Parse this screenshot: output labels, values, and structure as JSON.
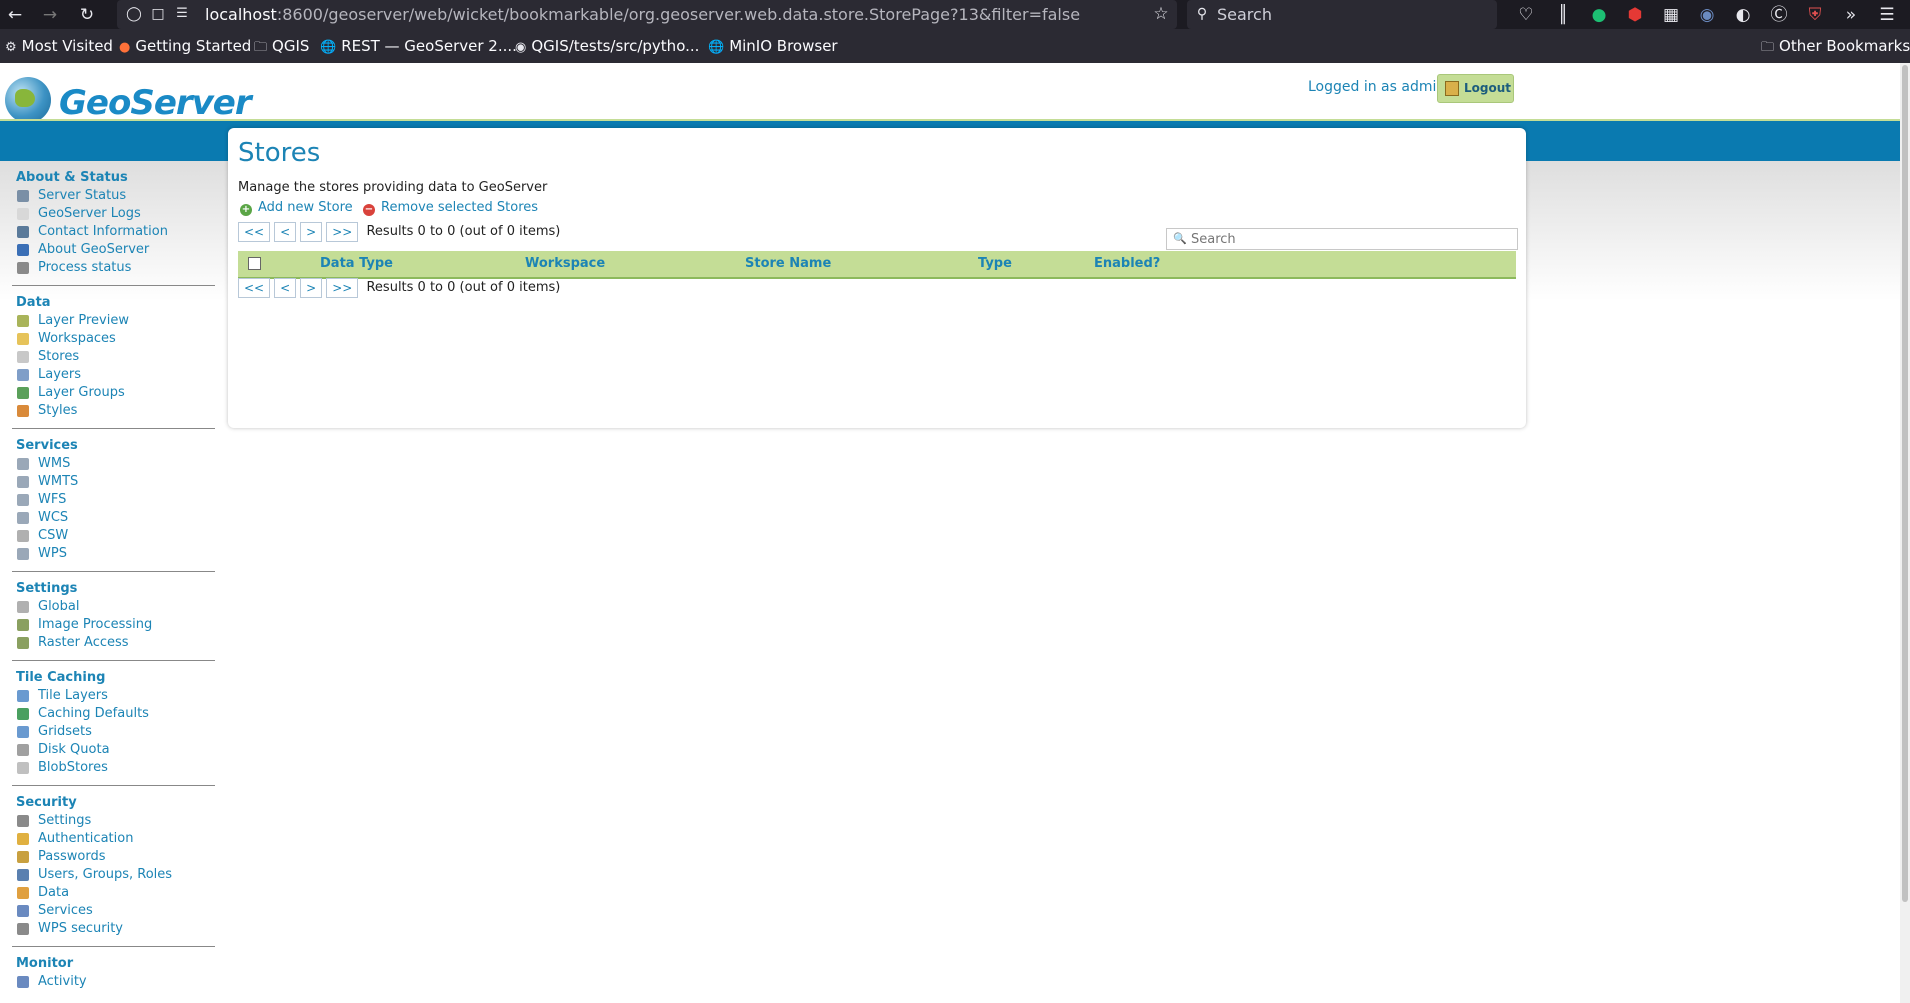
{
  "browser": {
    "url_host": "localhost",
    "url_path": ":8600/geoserver/web/wicket/bookmarkable/org.geoserver.web.data.store.StorePage?13&filter=false",
    "search_placeholder": "Search",
    "bookmarks": [
      "Most Visited",
      "Getting Started",
      "QGIS",
      "REST — GeoServer 2....",
      "QGIS/tests/src/pytho...",
      "MinIO Browser"
    ],
    "other_bookmarks": "Other Bookmarks"
  },
  "header": {
    "logo_text": "GeoServer",
    "logged_in": "Logged in as admin.",
    "logout_label": "Logout"
  },
  "sidebar": [
    {
      "title": "About & Status",
      "items": [
        {
          "label": "Server Status",
          "icon": "server-icon",
          "color": "#7a8fa6"
        },
        {
          "label": "GeoServer Logs",
          "icon": "document-icon",
          "color": "#d8d8d8"
        },
        {
          "label": "Contact Information",
          "icon": "contact-card-icon",
          "color": "#5a7a9a"
        },
        {
          "label": "About GeoServer",
          "icon": "info-icon",
          "color": "#3b6fb6"
        },
        {
          "label": "Process status",
          "icon": "gear-icon",
          "color": "#8a8a8a"
        }
      ]
    },
    {
      "title": "Data",
      "items": [
        {
          "label": "Layer Preview",
          "icon": "map-icon",
          "color": "#a9b45a"
        },
        {
          "label": "Workspaces",
          "icon": "folder-icon",
          "color": "#e6c35a"
        },
        {
          "label": "Stores",
          "icon": "database-icon",
          "color": "#c8c8c8"
        },
        {
          "label": "Layers",
          "icon": "layers-icon",
          "color": "#7f9ec8"
        },
        {
          "label": "Layer Groups",
          "icon": "layer-group-icon",
          "color": "#5aa05a"
        },
        {
          "label": "Styles",
          "icon": "palette-icon",
          "color": "#d98a3a"
        }
      ]
    },
    {
      "title": "Services",
      "items": [
        {
          "label": "WMS",
          "icon": "service-icon",
          "color": "#9aa8b8"
        },
        {
          "label": "WMTS",
          "icon": "service-icon",
          "color": "#9aa8b8"
        },
        {
          "label": "WFS",
          "icon": "service-icon",
          "color": "#9aa8b8"
        },
        {
          "label": "WCS",
          "icon": "service-icon",
          "color": "#9aa8b8"
        },
        {
          "label": "CSW",
          "icon": "service-icon",
          "color": "#b0b0b0"
        },
        {
          "label": "WPS",
          "icon": "service-icon",
          "color": "#9aa8b8"
        }
      ]
    },
    {
      "title": "Settings",
      "items": [
        {
          "label": "Global",
          "icon": "server-icon",
          "color": "#b0b0b0"
        },
        {
          "label": "Image Processing",
          "icon": "image-icon",
          "color": "#8aa060"
        },
        {
          "label": "Raster Access",
          "icon": "raster-icon",
          "color": "#8aa060"
        }
      ]
    },
    {
      "title": "Tile Caching",
      "items": [
        {
          "label": "Tile Layers",
          "icon": "grid-icon",
          "color": "#6a9ad0"
        },
        {
          "label": "Caching Defaults",
          "icon": "globe-icon",
          "color": "#4aa060"
        },
        {
          "label": "Gridsets",
          "icon": "grid-icon",
          "color": "#6a9ad0"
        },
        {
          "label": "Disk Quota",
          "icon": "disk-icon",
          "color": "#a0a0a0"
        },
        {
          "label": "BlobStores",
          "icon": "database-icon",
          "color": "#c0c0c0"
        }
      ]
    },
    {
      "title": "Security",
      "items": [
        {
          "label": "Settings",
          "icon": "wrench-icon",
          "color": "#8a8a8a"
        },
        {
          "label": "Authentication",
          "icon": "shield-icon",
          "color": "#e0b040"
        },
        {
          "label": "Passwords",
          "icon": "lock-icon",
          "color": "#c8a040"
        },
        {
          "label": "Users, Groups, Roles",
          "icon": "users-icon",
          "color": "#5a80b0"
        },
        {
          "label": "Data",
          "icon": "folder-lock-icon",
          "color": "#e0a040"
        },
        {
          "label": "Services",
          "icon": "service-lock-icon",
          "color": "#6a8ac0"
        },
        {
          "label": "WPS security",
          "icon": "gear-lock-icon",
          "color": "#8a8a8a"
        }
      ]
    },
    {
      "title": "Monitor",
      "items": [
        {
          "label": "Activity",
          "icon": "chart-icon",
          "color": "#6a8ac0"
        }
      ]
    }
  ],
  "main": {
    "title": "Stores",
    "description": "Manage the stores providing data to GeoServer",
    "add_label": "Add new Store",
    "remove_label": "Remove selected Stores",
    "pager": {
      "first": "<<",
      "prev": "<",
      "next": ">",
      "last": ">>",
      "info": "Results 0 to 0 (out of 0 items)"
    },
    "search_placeholder": "Search",
    "columns": [
      "Data Type",
      "Workspace",
      "Store Name",
      "Type",
      "Enabled?"
    ]
  }
}
